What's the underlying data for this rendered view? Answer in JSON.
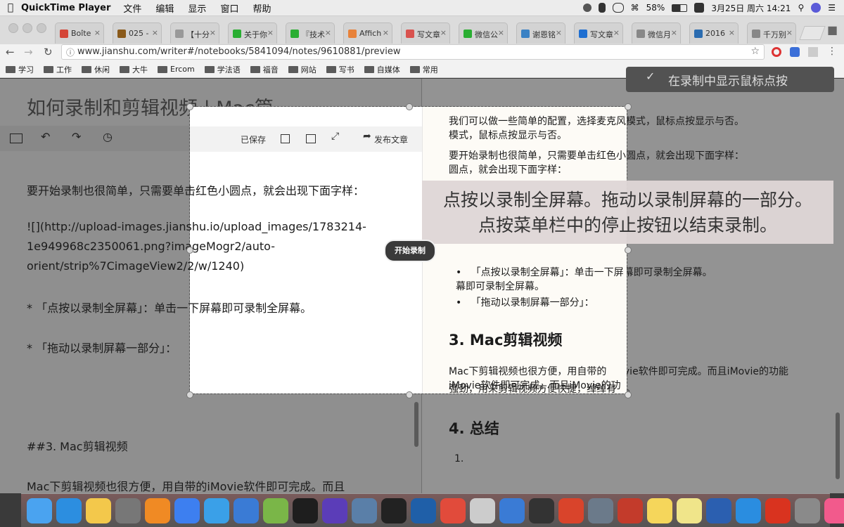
{
  "menubar": {
    "app": "QuickTime Player",
    "menus": [
      "文件",
      "编辑",
      "显示",
      "窗口",
      "帮助"
    ],
    "battery": "58%",
    "datetime": "3月25日 周六 14:21"
  },
  "tabs": [
    {
      "label": "Boîte",
      "color": "#d44638"
    },
    {
      "label": "025 -",
      "color": "#8a5a1a"
    },
    {
      "label": "【十分",
      "color": "#999999"
    },
    {
      "label": "关于你",
      "color": "#2aae32"
    },
    {
      "label": "『技术",
      "color": "#2aae32"
    },
    {
      "label": "Affich",
      "color": "#e8823a"
    },
    {
      "label": "写文章",
      "color": "#d9534f"
    },
    {
      "label": "微信公",
      "color": "#2aae32"
    },
    {
      "label": "谢恩铭",
      "color": "#3b82c4"
    },
    {
      "label": "写文章",
      "color": "#1f6fd1"
    },
    {
      "label": "微信月",
      "color": "#888888"
    },
    {
      "label": "2016",
      "color": "#2b6cb0"
    },
    {
      "label": "千万别",
      "color": "#888888"
    }
  ],
  "address": {
    "url": "www.jianshu.com/writer#/notebooks/5841094/notes/9610881/preview"
  },
  "bookmarks": [
    "学习",
    "工作",
    "休闲",
    "大牛",
    "Ercom",
    "学法语",
    "福音",
    "网站",
    "写书",
    "自媒体",
    "常用"
  ],
  "editor": {
    "title": "如何录制和剪辑视频 | Mac篇",
    "toolbar": {
      "saved": "已保存",
      "publish": "发布文章"
    },
    "lines": [
      "要开始录制也很简单，只需要单击红色小圆点，就会出现下面字样：",
      "![](http://upload-images.jianshu.io/upload_images/1783214-",
      "1e949968c2350061.png?imageMogr2/auto-",
      "orient/strip%7CimageView2/2/w/1240)",
      "* 「点按以录制全屏幕」：单击一下屏幕即可录制全屏幕。",
      "* 「拖动以录制屏幕一部分」：",
      "##3. Mac剪辑视频",
      "Mac下剪辑视频也很方便，用自带的iMovie软件即可完成。而且"
    ]
  },
  "preview": {
    "p1": "我们可以做一些简单的配置，选择麦克风模式，鼠标点按显示与否。",
    "p2": "要开始录制也很简单，只需要单击红色小圆点，就会出现下面字样：",
    "bullet1": "「点按以录制全屏幕」：单击一下屏幕即可录制全屏幕。",
    "bullet2": "「拖动以录制屏幕一部分」：",
    "h3": "3. Mac剪辑视频",
    "p3a": "Mac下剪辑视频也很方便，用自带的iMovie软件即可完成。而且iMovie的功能",
    "p3b": "强劲，用来剪辑视频方便快捷，绰绰有余。",
    "h4": "4. 总结",
    "li1": "1."
  },
  "overlay": {
    "banner_line1": "点按以录制全屏幕。拖动以录制屏幕的一部分。",
    "banner_line2": "点按菜单栏中的停止按钮以结束录制。",
    "record_button": "开始录制",
    "tip": "在录制中显示鼠标点按"
  },
  "dock_icons": [
    {
      "name": "finder-icon",
      "color": "#4aa3f0"
    },
    {
      "name": "safari-icon",
      "color": "#2c8ee0"
    },
    {
      "name": "photos-icon",
      "color": "#f3c84b"
    },
    {
      "name": "launchpad-icon",
      "color": "#777777"
    },
    {
      "name": "ibooks-icon",
      "color": "#f08a24"
    },
    {
      "name": "baidu-icon",
      "color": "#3d7ff0"
    },
    {
      "name": "xcode-bird-icon",
      "color": "#3aa0e8"
    },
    {
      "name": "quicktime-icon",
      "color": "#3a7bd5"
    },
    {
      "name": "android-studio-icon",
      "color": "#7ab648"
    },
    {
      "name": "terminal-icon",
      "color": "#1e1e1e"
    },
    {
      "name": "imovie-icon",
      "color": "#5b3db8"
    },
    {
      "name": "migration-icon",
      "color": "#5a7fa8"
    },
    {
      "name": "unity-icon",
      "color": "#222222"
    },
    {
      "name": "virtualbox-icon",
      "color": "#1f5fa8"
    },
    {
      "name": "chrome-icon",
      "color": "#e14b3b"
    },
    {
      "name": "mind-icon",
      "color": "#cccccc"
    },
    {
      "name": "files-icon",
      "color": "#3a7bd5"
    },
    {
      "name": "quicktime2-icon",
      "color": "#333333"
    },
    {
      "name": "wps-p-icon",
      "color": "#d9442b"
    },
    {
      "name": "atom-icon",
      "color": "#6b7a8a"
    },
    {
      "name": "preview-icon",
      "color": "#c33b2b"
    },
    {
      "name": "notes-icon",
      "color": "#f5d65b"
    },
    {
      "name": "stickies-icon",
      "color": "#f0e58a"
    },
    {
      "name": "word-icon",
      "color": "#2b5fb0"
    },
    {
      "name": "appstore-icon",
      "color": "#2a8de0"
    },
    {
      "name": "xmind-icon",
      "color": "#d9331f"
    },
    {
      "name": "settings-icon",
      "color": "#8a8a8a"
    },
    {
      "name": "music-icon",
      "color": "#f25a8c"
    },
    {
      "name": "trash-icon",
      "color": "#bfbfbf"
    }
  ]
}
